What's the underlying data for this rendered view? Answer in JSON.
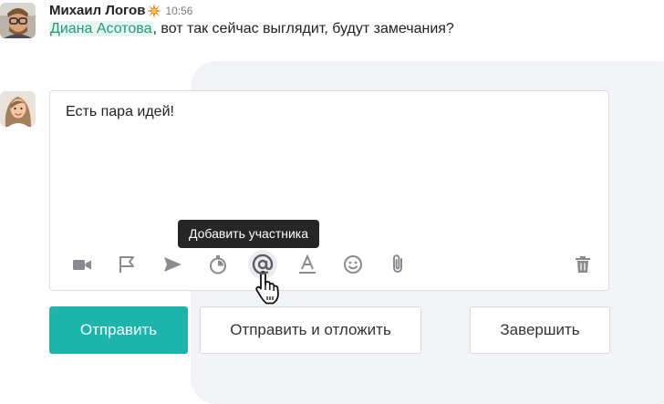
{
  "message": {
    "author_name": "Михаил Логов",
    "time": "10:56",
    "mention": "Диана Асотова",
    "text_rest": ", вот так сейчас выглядит, будут замечания?"
  },
  "composer": {
    "text": "Есть пара идей!",
    "toolbar": [
      {
        "name": "video-icon"
      },
      {
        "name": "flag-icon"
      },
      {
        "name": "send-arrow-icon"
      },
      {
        "name": "timer-icon"
      },
      {
        "name": "at-sign-icon"
      },
      {
        "name": "text-format-icon"
      },
      {
        "name": "emoji-icon"
      },
      {
        "name": "paperclip-icon"
      },
      {
        "name": "trash-icon"
      }
    ],
    "tooltip": "Добавить участника"
  },
  "actions": {
    "send_label": "Отправить",
    "send_postpone_label": "Отправить и отложить",
    "finish_label": "Завершить"
  },
  "colors": {
    "accent": "#1cb5ab",
    "mention_text": "#1e9c7c",
    "mention_bg": "#e7f6f1",
    "icon": "#8a8b90",
    "tooltip_bg": "#262626"
  }
}
